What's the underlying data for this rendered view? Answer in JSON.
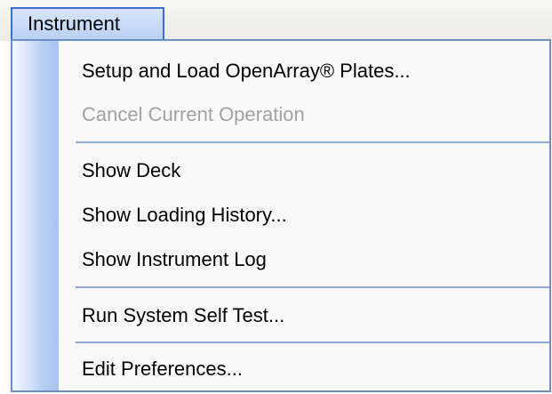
{
  "menubar": {
    "title": "Instrument"
  },
  "menu": {
    "items": [
      {
        "label": "Setup and Load OpenArray® Plates...",
        "enabled": true
      },
      {
        "label": "Cancel Current Operation",
        "enabled": false
      },
      {
        "label": "Show Deck",
        "enabled": true
      },
      {
        "label": "Show Loading History...",
        "enabled": true
      },
      {
        "label": "Show Instrument Log",
        "enabled": true
      },
      {
        "label": "Run System Self Test...",
        "enabled": true
      },
      {
        "label": "Edit Preferences...",
        "enabled": true
      }
    ]
  },
  "colors": {
    "menu_title_border": "#3d6fcf",
    "separator": "#8ea7d3",
    "disabled_text": "#a2a2a2",
    "gutter": "#a6c2ef"
  }
}
